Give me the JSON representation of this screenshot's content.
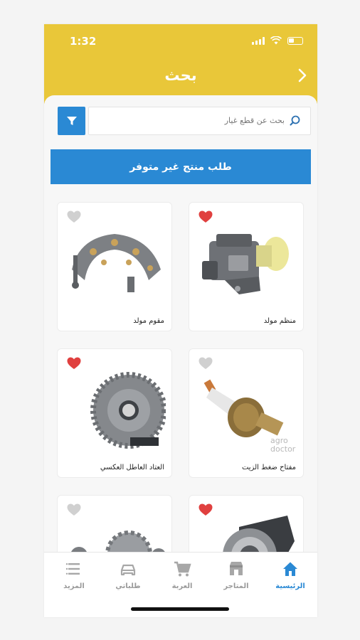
{
  "status": {
    "time": "1:32"
  },
  "header": {
    "title": "بحث"
  },
  "search": {
    "placeholder": "بحث عن قطع غيار"
  },
  "request_button": "طلب منتج غير متوفر",
  "products": [
    {
      "name": "منظم مولد",
      "favorite": true,
      "color": "#e0403f"
    },
    {
      "name": "مقوم مولد",
      "favorite": false,
      "color": "#d0d0d0"
    },
    {
      "name": "مفتاح ضغط الزيت",
      "favorite": false,
      "color": "#d0d0d0"
    },
    {
      "name": "العتاد العاطل العكسي",
      "favorite": true,
      "color": "#e0403f"
    },
    {
      "name": "",
      "favorite": true,
      "color": "#e0403f"
    },
    {
      "name": "",
      "favorite": false,
      "color": "#d0d0d0"
    }
  ],
  "watermark": "agro doctor",
  "nav": [
    {
      "label": "الرئيسية",
      "icon": "home-icon",
      "active": true
    },
    {
      "label": "المتاجر",
      "icon": "store-icon",
      "active": false
    },
    {
      "label": "العربة",
      "icon": "cart-icon",
      "active": false
    },
    {
      "label": "طلباتي",
      "icon": "car-icon",
      "active": false
    },
    {
      "label": "المزيد",
      "icon": "menu-icon",
      "active": false
    }
  ],
  "colors": {
    "header": "#e9c739",
    "accent": "#2a89d4",
    "heart_on": "#e0403f",
    "heart_off": "#d0d0d0"
  }
}
